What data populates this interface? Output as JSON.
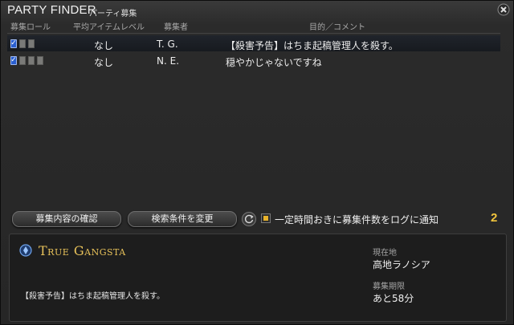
{
  "window": {
    "title": "PARTY FINDER",
    "subtitle": "パーティ募集"
  },
  "headers": {
    "roles": "募集ロール",
    "avg_item_level": "平均アイテムレベル",
    "recruiter": "募集者",
    "purpose": "目的／コメント"
  },
  "listings": [
    {
      "item_level": "なし",
      "recruiter": "T. G.",
      "comment": "【殺害予告】はちま起稿管理人を殺す。",
      "selected": true
    },
    {
      "item_level": "なし",
      "recruiter": "N. E.",
      "comment": "穏やかじゃないですね",
      "selected": false
    }
  ],
  "buttons": {
    "view_details": "募集内容の確認",
    "change_search": "検索条件を変更"
  },
  "notify": {
    "checked": true,
    "label": "一定時間おきに募集件数をログに通知"
  },
  "page_number": "2",
  "detail": {
    "leader_name": "True Gangsta",
    "comment": "【殺害予告】はちま起稿管理人を殺す。",
    "location_label": "現在地",
    "location_value": "高地ラノシア",
    "expiry_label": "募集期限",
    "expiry_value": "あと58分"
  },
  "colors": {
    "accent_gold": "#e8c25a",
    "checkbox_blue": "#2a5fd0",
    "notify_checkbox": "#e8b22a"
  },
  "icons": {
    "close": "close-icon",
    "refresh": "refresh-icon",
    "job": "job-crystal-icon"
  }
}
